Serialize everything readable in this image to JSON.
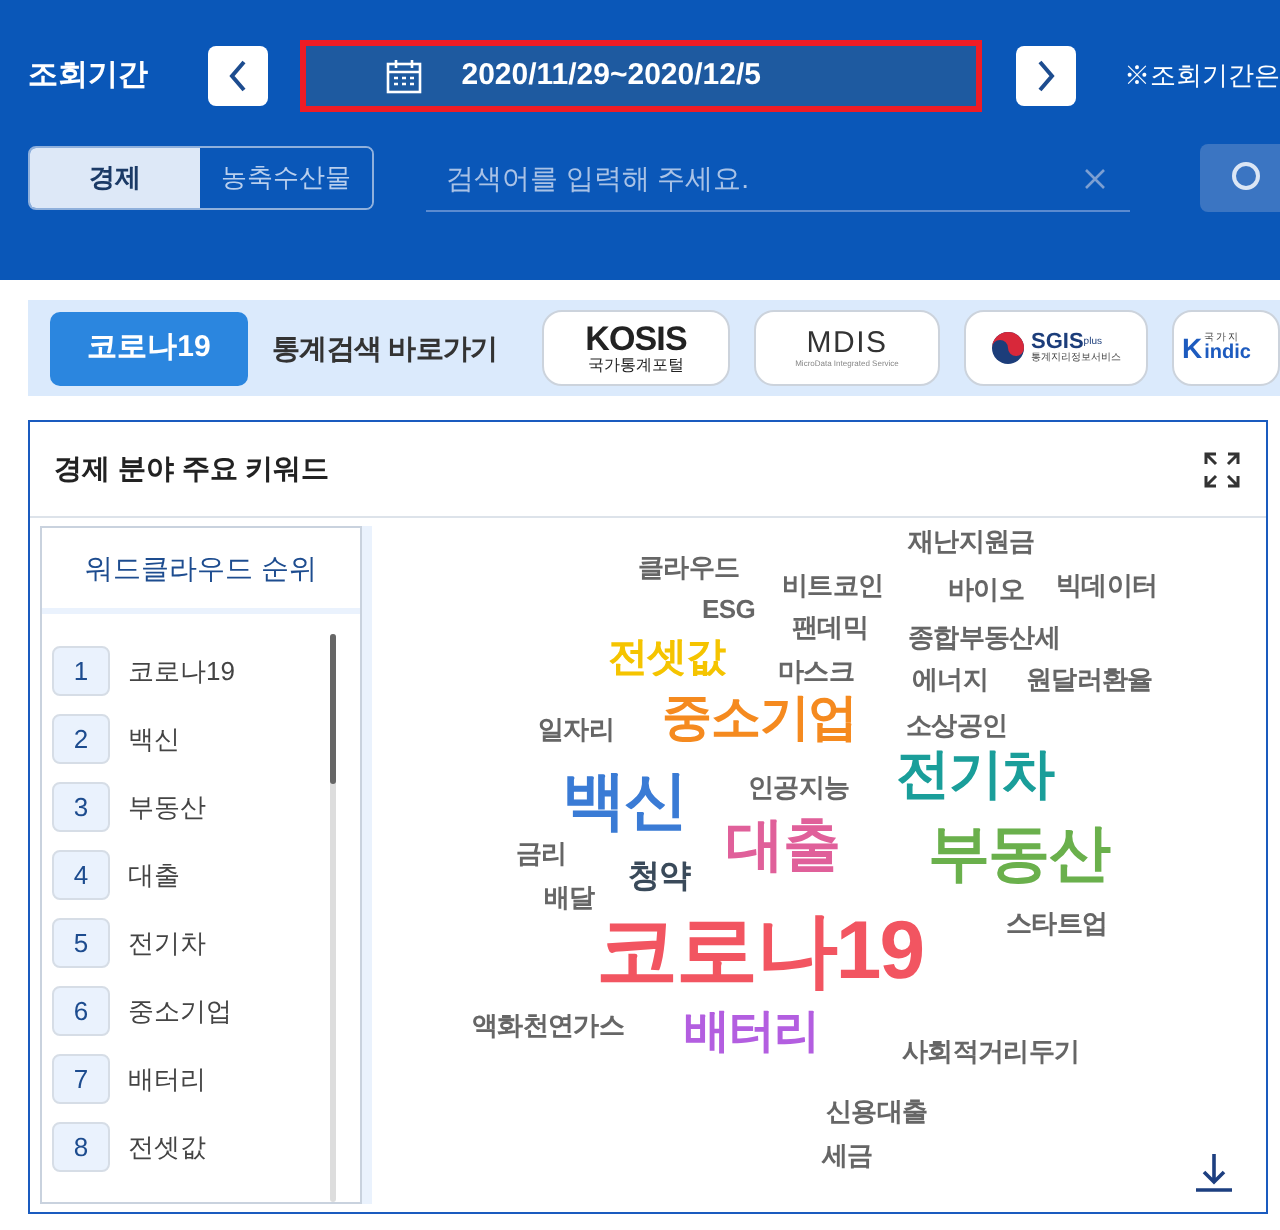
{
  "period": {
    "label": "조회기간",
    "date_range": "2020/11/29~2020/12/5",
    "note": "※조회기간은",
    "highlighted": true
  },
  "categories": [
    {
      "label": "경제",
      "selected": true
    },
    {
      "label": "농축수산물",
      "selected": false
    }
  ],
  "search": {
    "placeholder": "검색어를 입력해 주세요."
  },
  "shortcut_bar": {
    "covid_button": "코로나19",
    "title": "통계검색 바로가기",
    "links": [
      {
        "kind": "kosis",
        "name": "KOSIS",
        "subtitle": "국가통계포털"
      },
      {
        "kind": "mdis",
        "name": "MDIS",
        "subtitle": "MicroData Integrated Service"
      },
      {
        "kind": "sgis",
        "name": "SGIS",
        "tag": "plus",
        "subtitle": "통계지리정보서비스"
      },
      {
        "kind": "indicator",
        "mark": "K",
        "name": "indic",
        "subtitle": "국가지"
      }
    ]
  },
  "panel": {
    "title": "경제 분야 주요 키워드",
    "ranking": {
      "title": "워드클라우드 순위",
      "items": [
        {
          "rank": "1",
          "word": "코로나19"
        },
        {
          "rank": "2",
          "word": "백신"
        },
        {
          "rank": "3",
          "word": "부동산"
        },
        {
          "rank": "4",
          "word": "대출"
        },
        {
          "rank": "5",
          "word": "전기차"
        },
        {
          "rank": "6",
          "word": "중소기업"
        },
        {
          "rank": "7",
          "word": "배터리"
        },
        {
          "rank": "8",
          "word": "전셋값"
        }
      ]
    },
    "word_cloud": [
      {
        "word": "재난지원금",
        "color": "#666666"
      },
      {
        "word": "클라우드",
        "color": "#666666"
      },
      {
        "word": "비트코인",
        "color": "#666666"
      },
      {
        "word": "바이오",
        "color": "#666666"
      },
      {
        "word": "빅데이터",
        "color": "#666666"
      },
      {
        "word": "ESG",
        "color": "#666666"
      },
      {
        "word": "팬데믹",
        "color": "#666666"
      },
      {
        "word": "종합부동산세",
        "color": "#666666"
      },
      {
        "word": "전셋값",
        "color": "#f5c400"
      },
      {
        "word": "마스크",
        "color": "#666666"
      },
      {
        "word": "에너지",
        "color": "#666666"
      },
      {
        "word": "원달러환율",
        "color": "#666666"
      },
      {
        "word": "일자리",
        "color": "#666666"
      },
      {
        "word": "중소기업",
        "color": "#f58a1f"
      },
      {
        "word": "소상공인",
        "color": "#666666"
      },
      {
        "word": "전기차",
        "color": "#1a9e9a"
      },
      {
        "word": "백신",
        "color": "#3a7bd5"
      },
      {
        "word": "인공지능",
        "color": "#666666"
      },
      {
        "word": "금리",
        "color": "#666666"
      },
      {
        "word": "청약",
        "color": "#3a4a5a"
      },
      {
        "word": "대출",
        "color": "#e0609a"
      },
      {
        "word": "부동산",
        "color": "#6ab04c"
      },
      {
        "word": "배달",
        "color": "#666666"
      },
      {
        "word": "코로나19",
        "color": "#f25561"
      },
      {
        "word": "스타트업",
        "color": "#666666"
      },
      {
        "word": "액화천연가스",
        "color": "#666666"
      },
      {
        "word": "배터리",
        "color": "#b35ee0"
      },
      {
        "word": "사회적거리두기",
        "color": "#666666"
      },
      {
        "word": "신용대출",
        "color": "#666666"
      },
      {
        "word": "세금",
        "color": "#666666"
      }
    ]
  }
}
